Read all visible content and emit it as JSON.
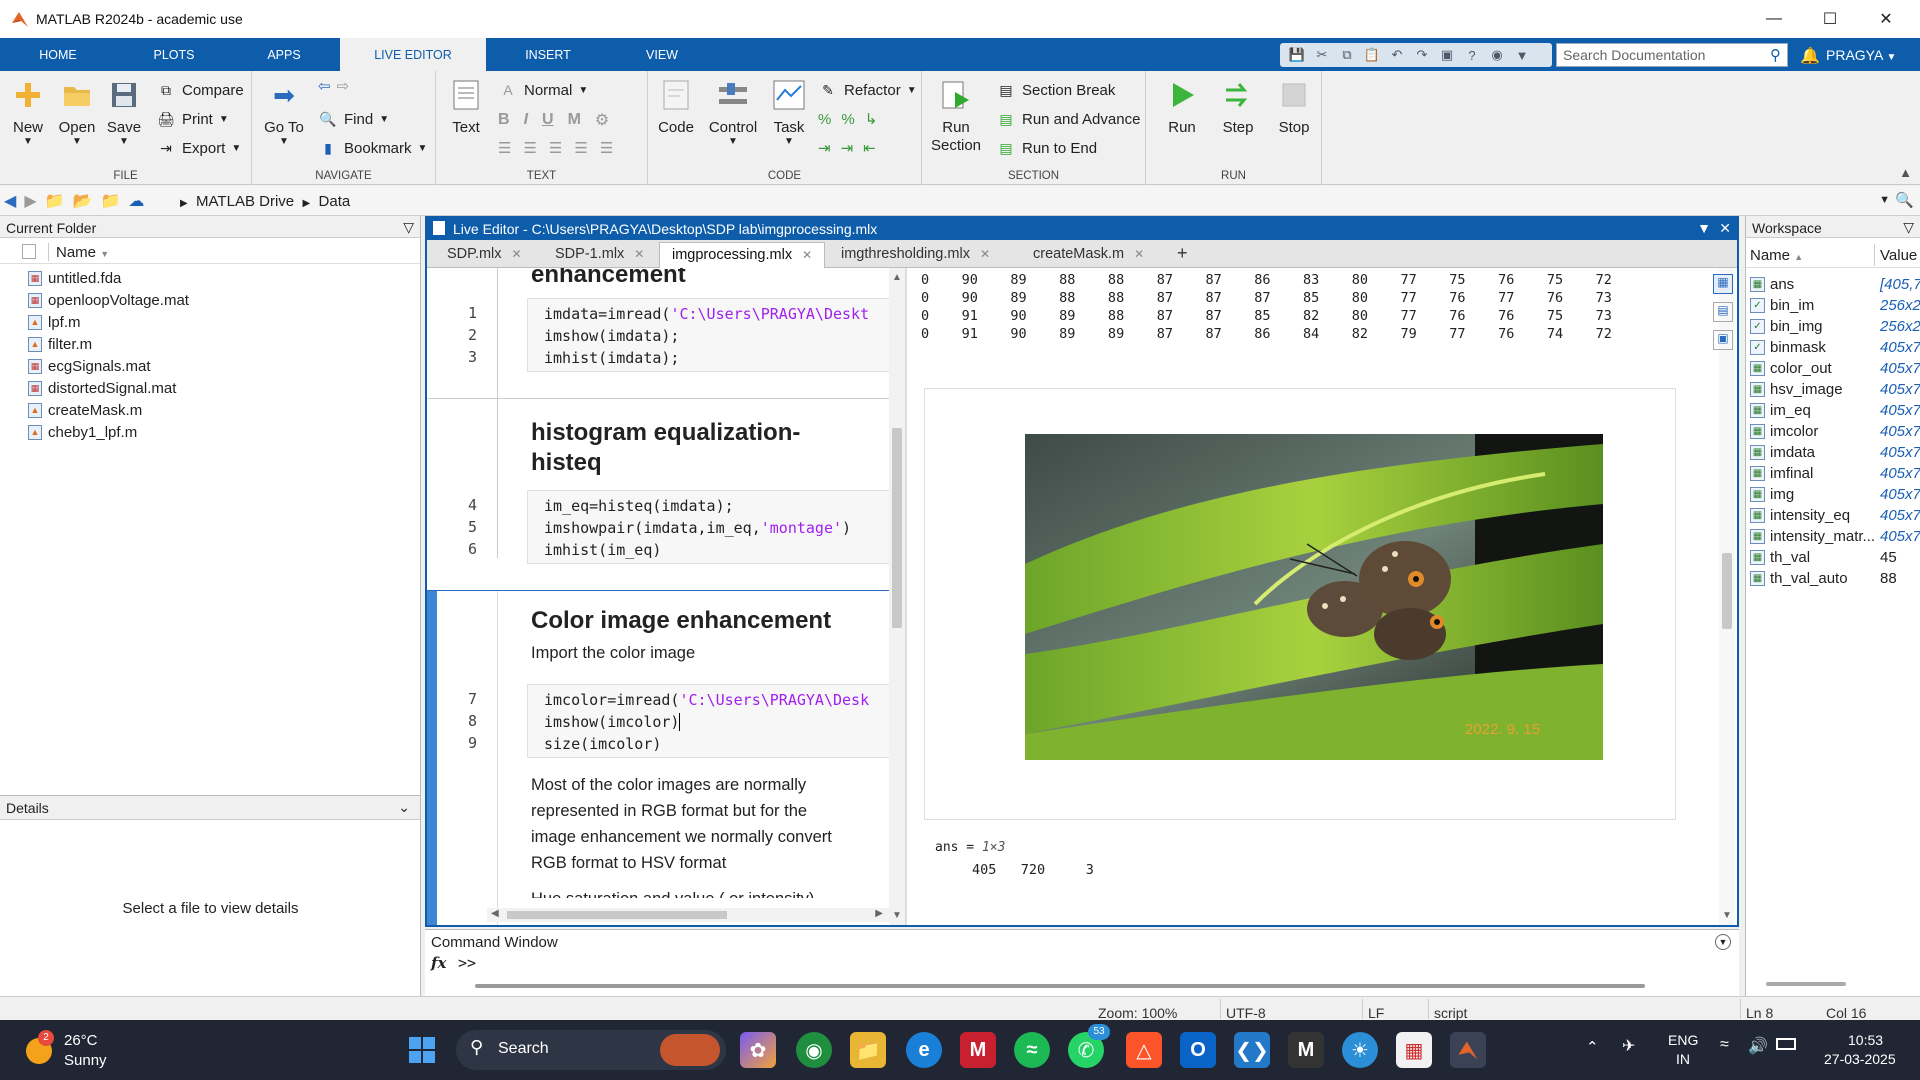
{
  "window": {
    "title": "MATLAB R2024b - academic use"
  },
  "ribbon_tabs": [
    "HOME",
    "PLOTS",
    "APPS",
    "LIVE EDITOR",
    "INSERT",
    "VIEW"
  ],
  "search": {
    "placeholder": "Search Documentation"
  },
  "user": "PRAGYA",
  "ribbon": {
    "file": {
      "title": "FILE",
      "new": "New",
      "open": "Open",
      "save": "Save",
      "compare": "Compare",
      "print": "Print",
      "export": "Export"
    },
    "navigate": {
      "title": "NAVIGATE",
      "goto": "Go To",
      "find": "Find",
      "bookmark": "Bookmark"
    },
    "text": {
      "title": "TEXT",
      "style": "Normal",
      "text": "Text"
    },
    "code": {
      "title": "CODE",
      "code": "Code",
      "control": "Control",
      "task": "Task",
      "refactor": "Refactor"
    },
    "section": {
      "title": "SECTION",
      "run_section": "Run Section",
      "section_break": "Section Break",
      "run_advance": "Run and Advance",
      "run_to_end": "Run to End"
    },
    "run": {
      "title": "RUN",
      "run": "Run",
      "step": "Step",
      "stop": "Stop"
    }
  },
  "address": {
    "crumb1": "MATLAB Drive",
    "crumb2": "Data"
  },
  "current_folder": {
    "title": "Current Folder",
    "column": "Name",
    "files": [
      "untitled.fda",
      "openloopVoltage.mat",
      "lpf.m",
      "filter.m",
      "ecgSignals.mat",
      "distortedSignal.mat",
      "createMask.m",
      "cheby1_lpf.m"
    ]
  },
  "details": {
    "title": "Details",
    "message": "Select a file to view details"
  },
  "editor": {
    "title": "Live Editor - C:\\Users\\PRAGYA\\Desktop\\SDP lab\\imgprocessing.mlx",
    "tabs": [
      "SDP.mlx",
      "SDP-1.mlx",
      "imgprocessing.mlx",
      "imgthresholding.mlx",
      "createMask.m"
    ],
    "cut_heading": "enhancement",
    "block1": [
      "imdata=imread(",
      "'C:\\Users\\PRAGYA\\Deskt",
      "imshow(imdata);",
      "imhist(imdata);"
    ],
    "heading2_a": "histogram equalization-",
    "heading2_b": "histeq",
    "block2": [
      "im_eq=histeq(imdata);",
      "imshowpair(imdata,im_eq,",
      "'montage'",
      ")",
      "imhist(im_eq)"
    ],
    "heading3": "Color image enhancement",
    "para1": "Import the color image",
    "block3": [
      "imcolor=imread(",
      "'C:\\Users\\PRAGYA\\Desk",
      "imshow(imcolor)",
      "size(imcolor)"
    ],
    "para2": [
      "Most of the color images are normally",
      "represented in RGB format but for the",
      "image enhancement we normally convert",
      "RGB format to HSV format"
    ],
    "para3_cut": "Hue saturation and value ( or intensity)",
    "line_numbers": [
      "1",
      "2",
      "3",
      "4",
      "5",
      "6",
      "7",
      "8",
      "9"
    ]
  },
  "output": {
    "matrix_rows": [
      "0    90    89    88    88    87    87    86    83    80    77    75    76    75    72",
      "0    90    89    88    88    87    87    87    85    80    77    76    77    76    73",
      "0    91    90    89    88    87    87    85    82    80    77    76    76    75    73",
      "0    91    90    89    89    87    87    86    84    82    79    77    76    74    72"
    ],
    "photo_stamp": "2022. 9. 15",
    "ans_label": "ans = ",
    "ans_size": "1×3",
    "ans_values": "405   720     3"
  },
  "workspace": {
    "title": "Workspace",
    "col_name": "Name",
    "col_value": "Value",
    "vars": [
      {
        "name": "ans",
        "value": "[405,7"
      },
      {
        "name": "bin_im",
        "value": "256x2"
      },
      {
        "name": "bin_img",
        "value": "256x2"
      },
      {
        "name": "binmask",
        "value": "405x7"
      },
      {
        "name": "color_out",
        "value": "405x7"
      },
      {
        "name": "hsv_image",
        "value": "405x7"
      },
      {
        "name": "im_eq",
        "value": "405x7"
      },
      {
        "name": "imcolor",
        "value": "405x7"
      },
      {
        "name": "imdata",
        "value": "405x7"
      },
      {
        "name": "imfinal",
        "value": "405x7"
      },
      {
        "name": "img",
        "value": "405x7"
      },
      {
        "name": "intensity_eq",
        "value": "405x7"
      },
      {
        "name": "intensity_matr...",
        "value": "405x7"
      },
      {
        "name": "th_val",
        "value": "45"
      },
      {
        "name": "th_val_auto",
        "value": "88"
      }
    ]
  },
  "command_window": {
    "title": "Command Window",
    "fx": "fx",
    "prompt": ">>"
  },
  "statusbar": {
    "zoom": "Zoom: 100%",
    "encoding": "UTF-8",
    "eol": "LF",
    "type": "script",
    "ln": "Ln  8",
    "col": "Col  16"
  },
  "taskbar": {
    "weather_temp": "26°C",
    "weather_desc": "Sunny",
    "weather_badge": "2",
    "search": "Search",
    "whatsapp_badge": "53",
    "lang1": "ENG",
    "lang2": "IN",
    "time": "10:53",
    "date": "27-03-2025"
  }
}
